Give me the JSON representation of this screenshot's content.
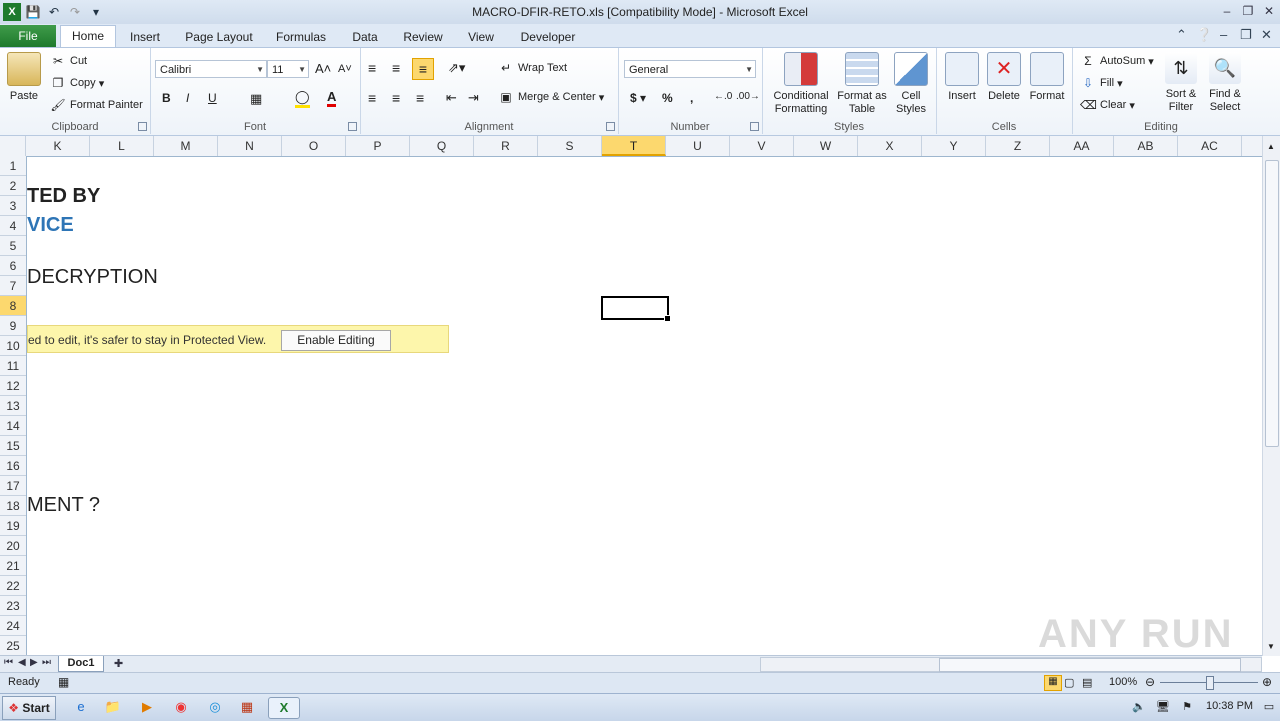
{
  "window": {
    "title": "MACRO-DFIR-RETO.xls  [Compatibility Mode]  -  Microsoft Excel",
    "app_icon": "excel-icon"
  },
  "tabs": {
    "file": "File",
    "items": [
      "Home",
      "Insert",
      "Page Layout",
      "Formulas",
      "Data",
      "Review",
      "View",
      "Developer"
    ],
    "active": "Home"
  },
  "ribbon": {
    "clipboard": {
      "paste": "Paste",
      "cut": "Cut",
      "copy": "Copy",
      "format_painter": "Format Painter",
      "label": "Clipboard"
    },
    "font": {
      "name": "Calibri",
      "size": "11",
      "label": "Font",
      "bold": "B",
      "italic": "I",
      "underline": "U"
    },
    "alignment": {
      "wrap_text": "Wrap Text",
      "merge_center": "Merge & Center",
      "label": "Alignment"
    },
    "number": {
      "format": "General",
      "currency": "$",
      "percent": "%",
      "comma": ",",
      "label": "Number"
    },
    "styles": {
      "conditional_formatting": "Conditional Formatting",
      "format_as_table": "Format as Table",
      "cell_styles": "Cell Styles",
      "label": "Styles"
    },
    "cells": {
      "insert": "Insert",
      "delete": "Delete",
      "format": "Format",
      "label": "Cells"
    },
    "editing": {
      "autosum": "AutoSum",
      "fill": "Fill",
      "clear": "Clear",
      "sort_filter": "Sort & Filter",
      "find_select": "Find & Select",
      "label": "Editing"
    }
  },
  "sheet": {
    "columns": [
      "K",
      "L",
      "M",
      "N",
      "O",
      "P",
      "Q",
      "R",
      "S",
      "T",
      "U",
      "V",
      "W",
      "X",
      "Y",
      "Z",
      "AA",
      "AB",
      "AC"
    ],
    "selected_column": "T",
    "rows": [
      "1",
      "2",
      "3",
      "4",
      "5",
      "6",
      "7",
      "8",
      "9",
      "10",
      "11",
      "12",
      "13",
      "14",
      "15",
      "16",
      "17",
      "18",
      "19",
      "20",
      "21",
      "22",
      "23",
      "24",
      "25"
    ],
    "selected_row": "8",
    "cell_texts": {
      "r3": "TED BY",
      "r4": "VICE",
      "r6": "DECRYPTION",
      "r18": "MENT ?"
    },
    "accent_color": "#2e75b6"
  },
  "protected_view": {
    "message": "ed to edit, it's safer to stay in Protected View.",
    "button": "Enable Editing"
  },
  "sheet_tabs": {
    "active": "Doc1"
  },
  "status": {
    "ready": "Ready",
    "zoom": "100%"
  },
  "taskbar": {
    "start": "Start",
    "time": "10:38 PM"
  },
  "watermark": "ANY RUN"
}
